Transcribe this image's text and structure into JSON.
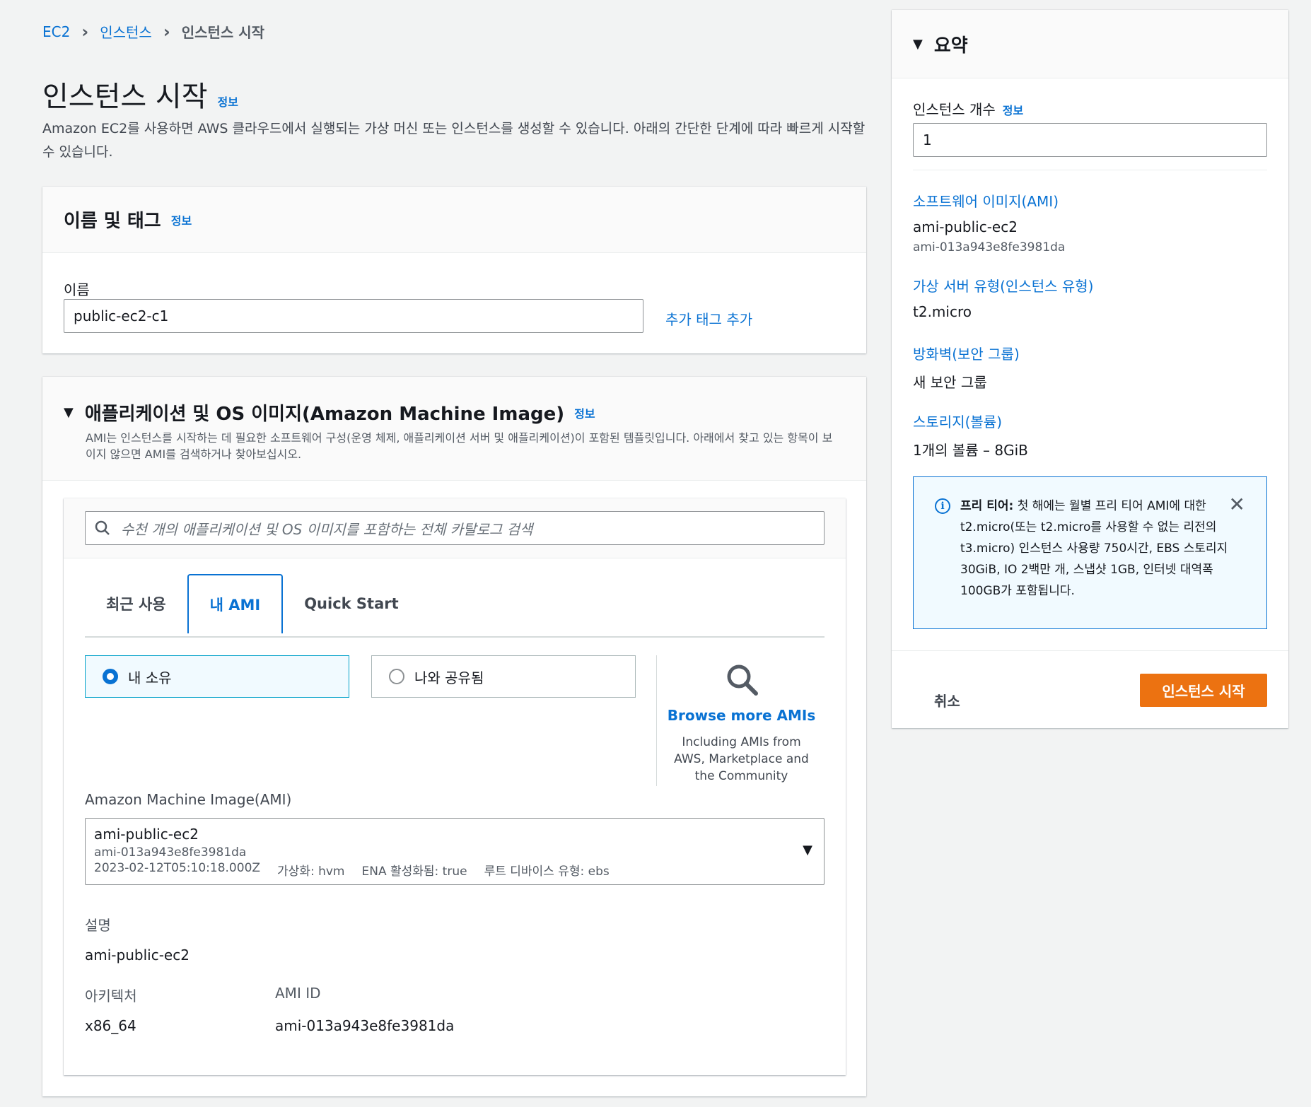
{
  "breadcrumb": {
    "items": [
      "EC2",
      "인스턴스"
    ],
    "current": "인스턴스 시작"
  },
  "page": {
    "title": "인스턴스 시작",
    "info": "정보",
    "description": "Amazon EC2를 사용하면 AWS 클라우드에서 실행되는 가상 머신 또는 인스턴스를 생성할 수 있습니다. 아래의 간단한 단계에 따라 빠르게 시작할 수 있습니다."
  },
  "name_tags": {
    "title": "이름 및 태그",
    "info": "정보",
    "name_label": "이름",
    "name_value": "public-ec2-c1",
    "add_tags": "추가 태그 추가"
  },
  "ami": {
    "title": "애플리케이션 및 OS 이미지(Amazon Machine Image)",
    "info": "정보",
    "description": "AMI는 인스턴스를 시작하는 데 필요한 소프트웨어 구성(운영 체제, 애플리케이션 서버 및 애플리케이션)이 포함된 템플릿입니다. 아래에서 찾고 있는 항목이 보이지 않으면 AMI를 검색하거나 찾아보십시오.",
    "search_placeholder": "수천 개의 애플리케이션 및 OS 이미지를 포함하는 전체 카탈로그 검색",
    "tabs": [
      "최근 사용",
      "내 AMI",
      "Quick Start"
    ],
    "active_tab": "내 AMI",
    "options": [
      "내 소유",
      "나와 공유됨"
    ],
    "selected_option": "내 소유",
    "browse_link": "Browse more AMIs",
    "browse_sub": "Including AMIs from AWS, Marketplace and the Community",
    "select_label": "Amazon Machine Image(AMI)",
    "selected": {
      "name": "ami-public-ec2",
      "id": "ami-013a943e8fe3981da",
      "date": "2023-02-12T05:10:18.000Z",
      "virtualization": "가상화: hvm",
      "ena": "ENA 활성화됨: true",
      "root_device": "루트 디바이스 유형: ebs"
    },
    "description_label": "설명",
    "description_value": "ami-public-ec2",
    "arch_label": "아키텍처",
    "arch_value": "x86_64",
    "ami_id_label": "AMI ID",
    "ami_id_value": "ami-013a943e8fe3981da"
  },
  "summary": {
    "title": "요약",
    "count_label": "인스턴스 개수",
    "info": "정보",
    "count_value": "1",
    "software_image_label": "소프트웨어 이미지(AMI)",
    "software_image_name": "ami-public-ec2",
    "software_image_id": "ami-013a943e8fe3981da",
    "instance_type_label": "가상 서버 유형(인스턴스 유형)",
    "instance_type_value": "t2.micro",
    "firewall_label": "방화벽(보안 그룹)",
    "firewall_value": "새 보안 그룹",
    "storage_label": "스토리지(볼륨)",
    "storage_value": "1개의 볼륨 – 8GiB",
    "free_tier_title": "프리 티어:",
    "free_tier_text": "첫 해에는 월별 프리 티어 AMI에 대한 t2.micro(또는 t2.micro를 사용할 수 없는 리전의 t3.micro) 인스턴스 사용량 750시간, EBS 스토리지 30GiB, IO 2백만 개, 스냅샷 1GB, 인터넷 대역폭 100GB가 포함됩니다.",
    "cancel": "취소",
    "launch": "인스턴스 시작"
  },
  "colors": {
    "link": "#0972d3",
    "primary": "#ec7211",
    "background": "#f2f3f3"
  }
}
